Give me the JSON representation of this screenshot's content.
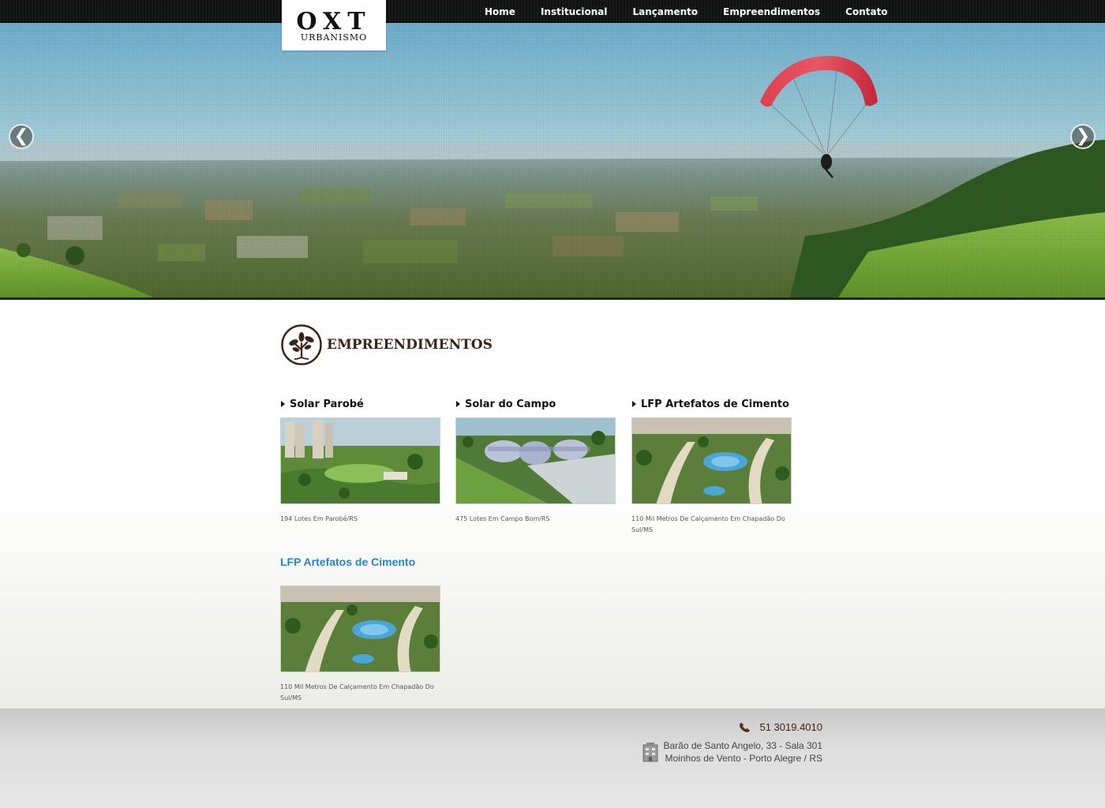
{
  "brand": {
    "logo_text": "OXT",
    "logo_sub": "URBANISMO"
  },
  "nav": {
    "items": [
      {
        "label": "Home"
      },
      {
        "label": "Institucional"
      },
      {
        "label": "Lançamento"
      },
      {
        "label": "Empreendimentos"
      },
      {
        "label": "Contato"
      }
    ]
  },
  "slider": {
    "prev_label": "❮",
    "next_label": "❯"
  },
  "section": {
    "title": "EMPREENDIMENTOS",
    "icon": "tree-icon"
  },
  "projects": [
    {
      "title": "Solar Parobé",
      "desc": "194 Lotes Em Parobé/RS"
    },
    {
      "title": "Solar do Campo",
      "desc": "475 Lotes Em Campo Bom/RS"
    },
    {
      "title": "LFP Artefatos de Cimento",
      "desc": "110 Mil Metros De Calçamento Em Chapadão Do Sul/MS"
    }
  ],
  "featured": {
    "title": "LFP Artefatos de Cimento",
    "desc": "110 Mil Metros De Calçamento Em Chapadão Do Sul/MS"
  },
  "footer": {
    "phone": "51 3019.4010",
    "address_line1": "Barão de Santo Angelo, 33 - Sala 301",
    "address_line2": "Moinhos de Vento - Porto Alegre / RS",
    "phone_icon": "phone-icon",
    "address_icon": "building-icon"
  },
  "colors": {
    "accent_brown": "#3d2314",
    "link_blue": "#2a84c4",
    "nav_bg": "#111111"
  }
}
